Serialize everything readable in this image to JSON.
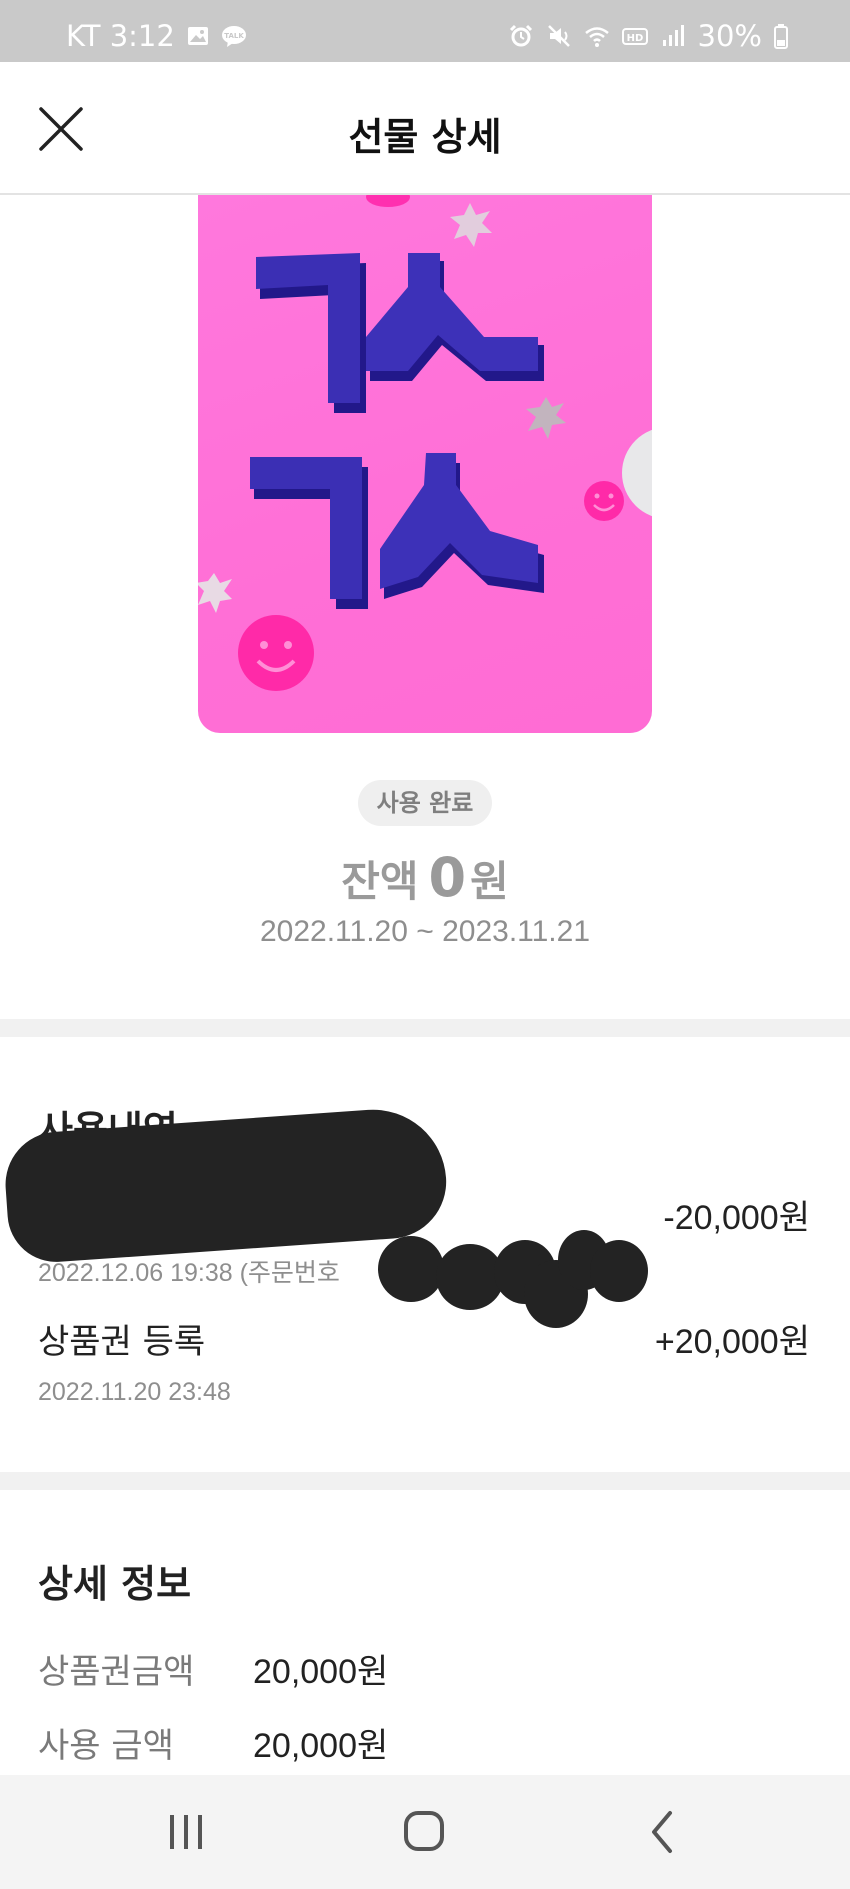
{
  "status_bar": {
    "carrier_time": "KT 3:12",
    "battery": "30%",
    "left_icons": [
      "image-icon",
      "talk-icon"
    ],
    "right_icons": [
      "alarm-icon",
      "mute-icon",
      "wifi-icon",
      "hd-icon",
      "signal-icon",
      "battery-icon"
    ]
  },
  "header": {
    "title": "선물 상세",
    "close_icon": "close-icon"
  },
  "gift": {
    "image_text": "ㄱㅅ ㄱㅅ",
    "status_badge": "사용 완료",
    "balance_label": "잔액",
    "balance_amount": "0",
    "balance_unit": "원",
    "validity": "2022.11.20 ~ 2023.11.21"
  },
  "history": {
    "title": "사용내역",
    "items": [
      {
        "label": "",
        "sub": "2022.12.06 19:38 (주문번호",
        "amount": "-20,000원",
        "redacted": true
      },
      {
        "label": "상품권 등록",
        "sub": "2022.11.20 23:48",
        "amount": "+20,000원",
        "redacted": false
      }
    ]
  },
  "details": {
    "title": "상세 정보",
    "rows": [
      {
        "label": "상품권금액",
        "value": "20,000원"
      },
      {
        "label": "사용 금액",
        "value": "20,000원"
      }
    ]
  },
  "nav": {
    "icons": [
      "recent-apps-icon",
      "home-icon",
      "back-icon"
    ]
  },
  "colors": {
    "card_pink": "#ff6fd6",
    "letters_indigo": "#3a2fb0",
    "badge_bg": "#efefef",
    "divider": "#f1f1f1"
  }
}
